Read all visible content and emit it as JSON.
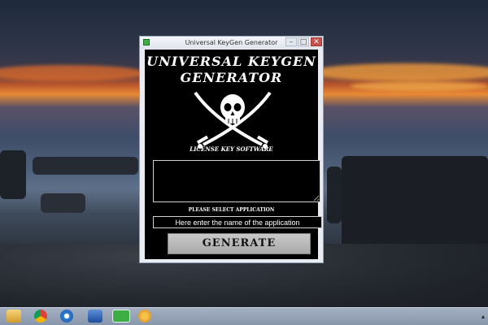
{
  "window": {
    "title": "Universal KeyGen Generator",
    "minimize_glyph": "–",
    "maximize_glyph": "□",
    "close_glyph": "✕"
  },
  "app": {
    "heading_line1": "UNIVERSAL KEYGEN",
    "heading_line2": "GENERATOR",
    "subtitle": "LICENSE KEY SOFTWARE",
    "select_label": "PLEASE SELECT APPLICATION",
    "app_name_value": "Here enter the name of the application",
    "generate_label": "GENERATE",
    "key_output_value": ""
  },
  "taskbar": {
    "items": [
      "explorer-icon",
      "chrome-icon",
      "ie-icon",
      "network-icon",
      "keygen-app-icon",
      "other-app-icon"
    ],
    "tray_glyph": "▴"
  },
  "colors": {
    "client_bg": "#000000",
    "text": "#ffffff",
    "button_bg": "#b5b5b5",
    "taskbar_bg": "#97a3b7"
  }
}
